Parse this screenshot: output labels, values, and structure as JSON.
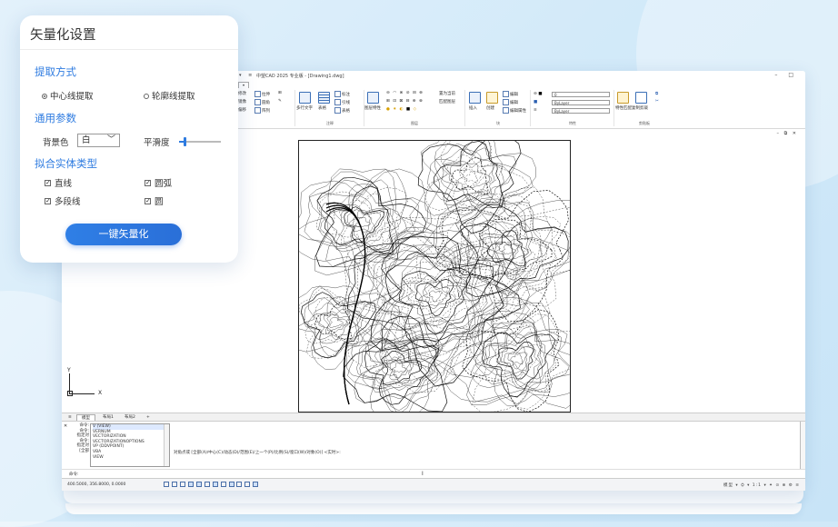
{
  "panel": {
    "title": "矢量化设置",
    "extract_section": "提取方式",
    "extract_options": [
      "中心线提取",
      "轮廓线提取"
    ],
    "extract_selected": "中心线提取",
    "params_section": "通用参数",
    "bg_label": "背景色",
    "bg_value": "白",
    "smooth_label": "平滑度",
    "smooth_level": 0.15,
    "entity_section": "拟合实体类型",
    "entities": [
      {
        "label": "直线",
        "checked": true
      },
      {
        "label": "圆弧",
        "checked": true
      },
      {
        "label": "多段线",
        "checked": true
      },
      {
        "label": "圆",
        "checked": true
      }
    ],
    "action_label": "一键矢量化"
  },
  "cad": {
    "title": "中望CAD 2025 专业版 - [Drawing1.dwg]",
    "quick_access": "▾  ≡",
    "window_controls": "–  □",
    "ribbon": {
      "col1": [
        "修改",
        "镜像",
        "偏移"
      ],
      "col2": [
        "拉伸",
        "圆角",
        "阵列"
      ],
      "text_label": "多行文字",
      "table_label": "表格",
      "col3": [
        "标注",
        "引线",
        "表格"
      ],
      "annotate_group": "注释",
      "layer_props_label": "图层特性",
      "col4": [
        "置为当前",
        "匹配图层"
      ],
      "layers_group": "图层",
      "insert_label": "插入",
      "create_label": "创建",
      "edit_label": "编辑",
      "edit_attr": "编辑属性",
      "block_group": "块",
      "layer_dd": "0",
      "color_dd": "ByLayer",
      "linetype_dd": "ByLayer",
      "lineweight_dd": "ByLayer",
      "props_group": "特性",
      "match_label": "特性匹配",
      "clipboard_paste": "粘贴",
      "clipboard_label": "复制剪裁",
      "clipboard_group": "剪贴板"
    },
    "view_controls": "–  ⧉  ✕",
    "ucs_x": "X",
    "ucs_y": "Y",
    "tabs": [
      "模型",
      "布局1",
      "布局2"
    ],
    "active_tab": "模型",
    "tab_add": "+",
    "tab_menu": "≡",
    "command_labels": [
      "命令:",
      "命令:",
      "指定对",
      "命令:",
      "指定对",
      "[全部"
    ],
    "autocomplete": [
      "V (VIEW)",
      "VERNUM",
      "VECTORIZATION",
      "VECTORIZATIONOPTIONS",
      "VP (DDVPOINT)",
      "VBA",
      "VIEW"
    ],
    "history": [
      "对角点或 [全部(A)/中心(C)/动态(D)/范围(E)/上一个(P)/比例(S)/窗口(W)/对象(O)] <实时>:"
    ],
    "prompt_label": "命令:",
    "coords": "400.5000, 356.8000, 0.0000",
    "status_right": "模型 ▾  ⛭ ▾  1:1 ▾  ✦ ⊙ ⊕ ⚙ ≡"
  }
}
